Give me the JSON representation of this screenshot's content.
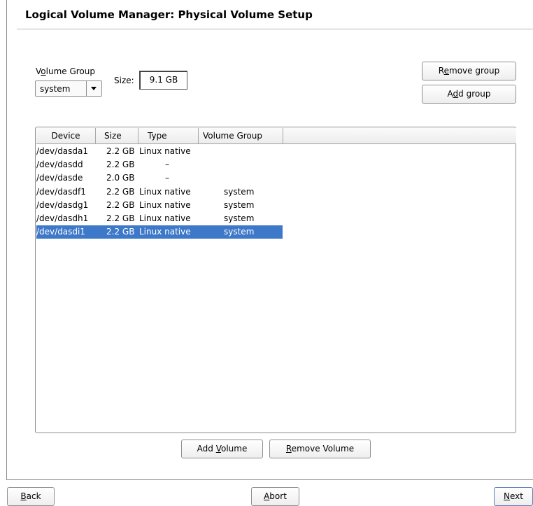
{
  "header": {
    "title": "Logical Volume Manager: Physical Volume Setup"
  },
  "volume_group": {
    "label_pre": "V",
    "label_mn": "o",
    "label_post": "lume Group",
    "selected": "system",
    "size_label": "Size:",
    "size_value": "9.1 GB"
  },
  "buttons": {
    "remove_group_pre": "R",
    "remove_group_mn": "e",
    "remove_group_post": "move group",
    "add_group_pre": "A",
    "add_group_mn": "d",
    "add_group_post": "d group",
    "add_volume_pre": "Add ",
    "add_volume_mn": "V",
    "add_volume_post": "olume",
    "remove_volume_pre": "",
    "remove_volume_mn": "R",
    "remove_volume_post": "emove Volume",
    "back_mn": "B",
    "back_post": "ack",
    "abort_mn": "A",
    "abort_post": "bort",
    "next_mn": "N",
    "next_post": "ext"
  },
  "table": {
    "columns": [
      "Device",
      "Size",
      "Type",
      "Volume Group"
    ],
    "rows": [
      {
        "device": "/dev/dasda1",
        "size": "2.2 GB",
        "type": "Linux native",
        "group": ""
      },
      {
        "device": "/dev/dasdd",
        "size": "2.2 GB",
        "type": "–",
        "group": ""
      },
      {
        "device": "/dev/dasde",
        "size": "2.0 GB",
        "type": "–",
        "group": ""
      },
      {
        "device": "/dev/dasdf1",
        "size": "2.2 GB",
        "type": "Linux native",
        "group": "system"
      },
      {
        "device": "/dev/dasdg1",
        "size": "2.2 GB",
        "type": "Linux native",
        "group": "system"
      },
      {
        "device": "/dev/dasdh1",
        "size": "2.2 GB",
        "type": "Linux native",
        "group": "system"
      },
      {
        "device": "/dev/dasdi1",
        "size": "2.2 GB",
        "type": "Linux native",
        "group": "system"
      }
    ],
    "selected_row": 6
  },
  "colors": {
    "selection": "#3d78c9",
    "border": "#8c8c8c"
  }
}
